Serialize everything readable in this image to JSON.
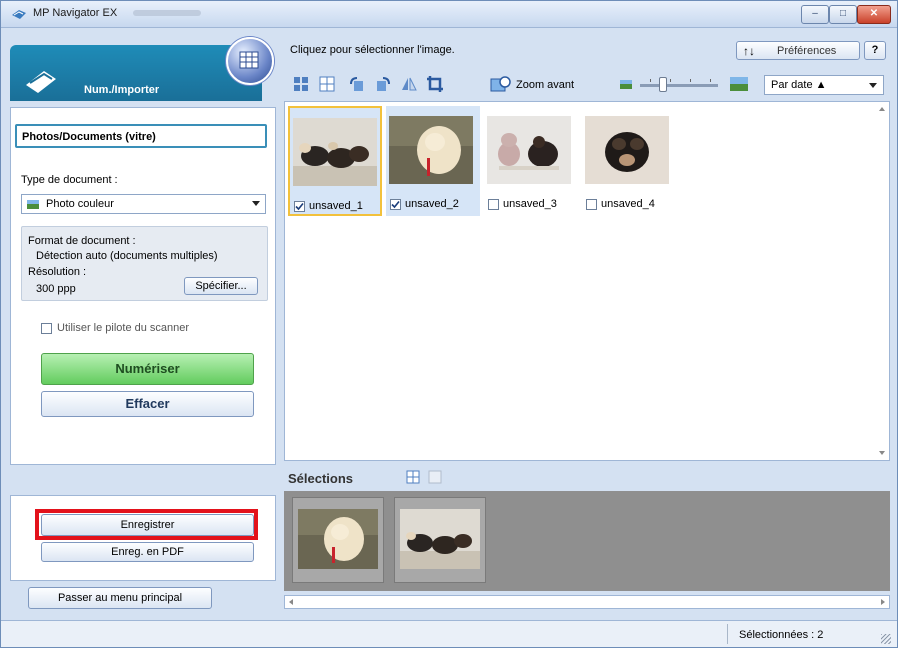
{
  "window": {
    "title": "MP Navigator EX",
    "minimize": "–",
    "maximize": "□",
    "close": "✕"
  },
  "left": {
    "mode_label": "Num./Importer",
    "source_field": "Photos/Documents (vitre)",
    "doc_type_label": "Type de document :",
    "doc_type_value": "Photo couleur",
    "format_label": "Format de document :",
    "format_value": "Détection auto (documents multiples)",
    "resolution_label": "Résolution :",
    "resolution_value": "300 ppp",
    "specify_button": "Spécifier...",
    "use_driver_label": "Utiliser le pilote du scanner",
    "use_driver_checked": false,
    "scan_button": "Numériser",
    "clear_button": "Effacer",
    "save_button": "Enregistrer",
    "save_pdf_button": "Enreg. en PDF",
    "main_menu_button": "Passer au menu principal"
  },
  "right": {
    "instruction": "Cliquez pour sélectionner l'image.",
    "preferences_button": "Préférences",
    "preferences_icon": "sort-arrows-icon",
    "help_button": "?",
    "zoom_label": "Zoom avant",
    "zoom_level": 0.3,
    "sort_value": "Par date ▲",
    "thumbnails": [
      {
        "name": "unsaved_1",
        "checked": true
      },
      {
        "name": "unsaved_2",
        "checked": true
      },
      {
        "name": "unsaved_3",
        "checked": false
      },
      {
        "name": "unsaved_4",
        "checked": false
      }
    ],
    "selections_label": "Sélections"
  },
  "status": {
    "selected_text": "Sélectionnées : 2"
  },
  "colors": {
    "accent": "#1f8cb8",
    "scan_green": "#63cc5e",
    "highlight": "#e3121b",
    "selection_border": "#f2c13c"
  }
}
